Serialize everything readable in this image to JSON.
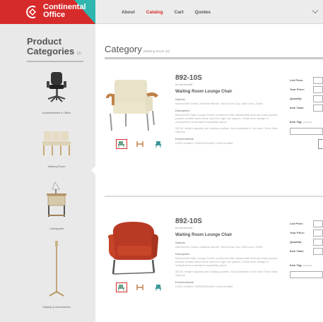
{
  "brand": {
    "line1": "Continental",
    "line2": "Office",
    "primary_color": "#d72a2a",
    "accent_color": "#2fb6ae"
  },
  "nav": [
    {
      "label": "About"
    },
    {
      "label": "Catalog",
      "active": true
    },
    {
      "label": "Cart"
    },
    {
      "label": "Quotes"
    }
  ],
  "sidebar": {
    "title_line1": "Product",
    "title_line2": "Categories",
    "title_suffix": "(3)",
    "items": [
      {
        "label": "Administrative & Office",
        "icon": "office-chair-icon"
      },
      {
        "label": "Waiting Room",
        "icon": "waiting-bench-icon"
      },
      {
        "label": "Casegoods",
        "icon": "side-table-icon"
      },
      {
        "label": "Display & Accessories",
        "icon": "floor-lamp-icon"
      }
    ]
  },
  "main": {
    "title": "Category",
    "subtitle": "(Waiting Room 33)"
  },
  "products": [
    {
      "sku": "892-10S",
      "brand": "by Nemschoff",
      "name": "Waiting Room Lounge Chair",
      "options_label": "Options",
      "options_text": "Nemschoff Cream, Meadow Barrier, Wood End Cap, Wall Lock, 20Wh",
      "description_label": "Description",
      "description_text": "Nemschoff Vitae Lounge Series contoured with replaceable seat and back panels, powder coated steel frame ideal for high use spaces. Clean lines design to complement a standard hospitality space.",
      "capacity_text": "300 lb. weight capacity per seating position. Also Available in Two and Three Seat Options",
      "environment_label": "Environmental",
      "environment_text": "LEED certified, GREENGUARD Gold certified",
      "image_icon": "lounge-chair-beige-icon",
      "swatch_icons": [
        "chair-swatch-icon",
        "frame-swatch-icon",
        "side-chair-swatch-icon"
      ]
    },
    {
      "sku": "892-10S",
      "brand": "by Nemschoff",
      "name": "Waiting Room Lounge Chair",
      "options_label": "Options",
      "options_text": "Nemschoff Cream, Meadow Barrier, Wood End Cap, Wall Lock, 20Wh",
      "description_label": "Description",
      "description_text": "Nemschoff Vitae Lounge Series contoured with replaceable seat and back panels, powder coated steel frame ideal for high use spaces. Clean lines design to complement a standard hospitality space.",
      "capacity_text": "300 lb. weight capacity per seating position. Also Available in Two and Three Seat Options",
      "environment_label": "Environmental",
      "environment_text": "LEED certified, GREENGUARD Gold certified",
      "image_icon": "lounge-chair-red-icon",
      "swatch_icons": [
        "chair-swatch-icon",
        "frame-swatch-icon",
        "side-chair-swatch-icon"
      ]
    }
  ],
  "pricing": {
    "list_price": "List Price:",
    "your_price": "Your Price:",
    "quantity": "Quantity:",
    "item_total": "Item Total:",
    "item_tag": "Item Tag:",
    "item_tag_hint": "(optional)"
  }
}
